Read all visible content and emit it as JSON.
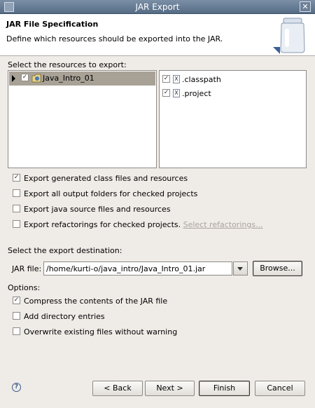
{
  "window": {
    "title": "JAR Export",
    "close_glyph": "✕"
  },
  "header": {
    "title": "JAR File Specification",
    "description": "Define which resources should be exported into the JAR.",
    "graphic": "jar-icon"
  },
  "resources": {
    "label": "Select the resources to export:",
    "tree": [
      {
        "label": "Java_Intro_01",
        "checked": true,
        "expanded": false,
        "icon": "java-project-icon"
      }
    ],
    "files": [
      {
        "label": ".classpath",
        "checked": true,
        "icon": "x-file-icon",
        "icon_glyph": "X"
      },
      {
        "label": ".project",
        "checked": true,
        "icon": "x-file-icon",
        "icon_glyph": "X"
      }
    ]
  },
  "export_options": [
    {
      "label": "Export generated class files and resources",
      "checked": true
    },
    {
      "label": "Export all output folders for checked projects",
      "checked": false
    },
    {
      "label": "Export java source files and resources",
      "checked": false
    },
    {
      "label": "Export refactorings for checked projects.",
      "checked": false,
      "link": "Select refactorings..."
    }
  ],
  "destination": {
    "label": "Select the export destination:",
    "jar_file_label": "JAR file:",
    "jar_file_value": "/home/kurti-o/java_intro/Java_Intro_01.jar",
    "browse_label": "Browse..."
  },
  "options": {
    "label": "Options:",
    "items": [
      {
        "label": "Compress the contents of the JAR file",
        "checked": true
      },
      {
        "label": "Add directory entries",
        "checked": false
      },
      {
        "label": "Overwrite existing files without warning",
        "checked": false
      }
    ]
  },
  "buttons": {
    "back": "< Back",
    "next": "Next >",
    "finish": "Finish",
    "cancel": "Cancel"
  },
  "check_glyph": "✓",
  "help_glyph": "?"
}
